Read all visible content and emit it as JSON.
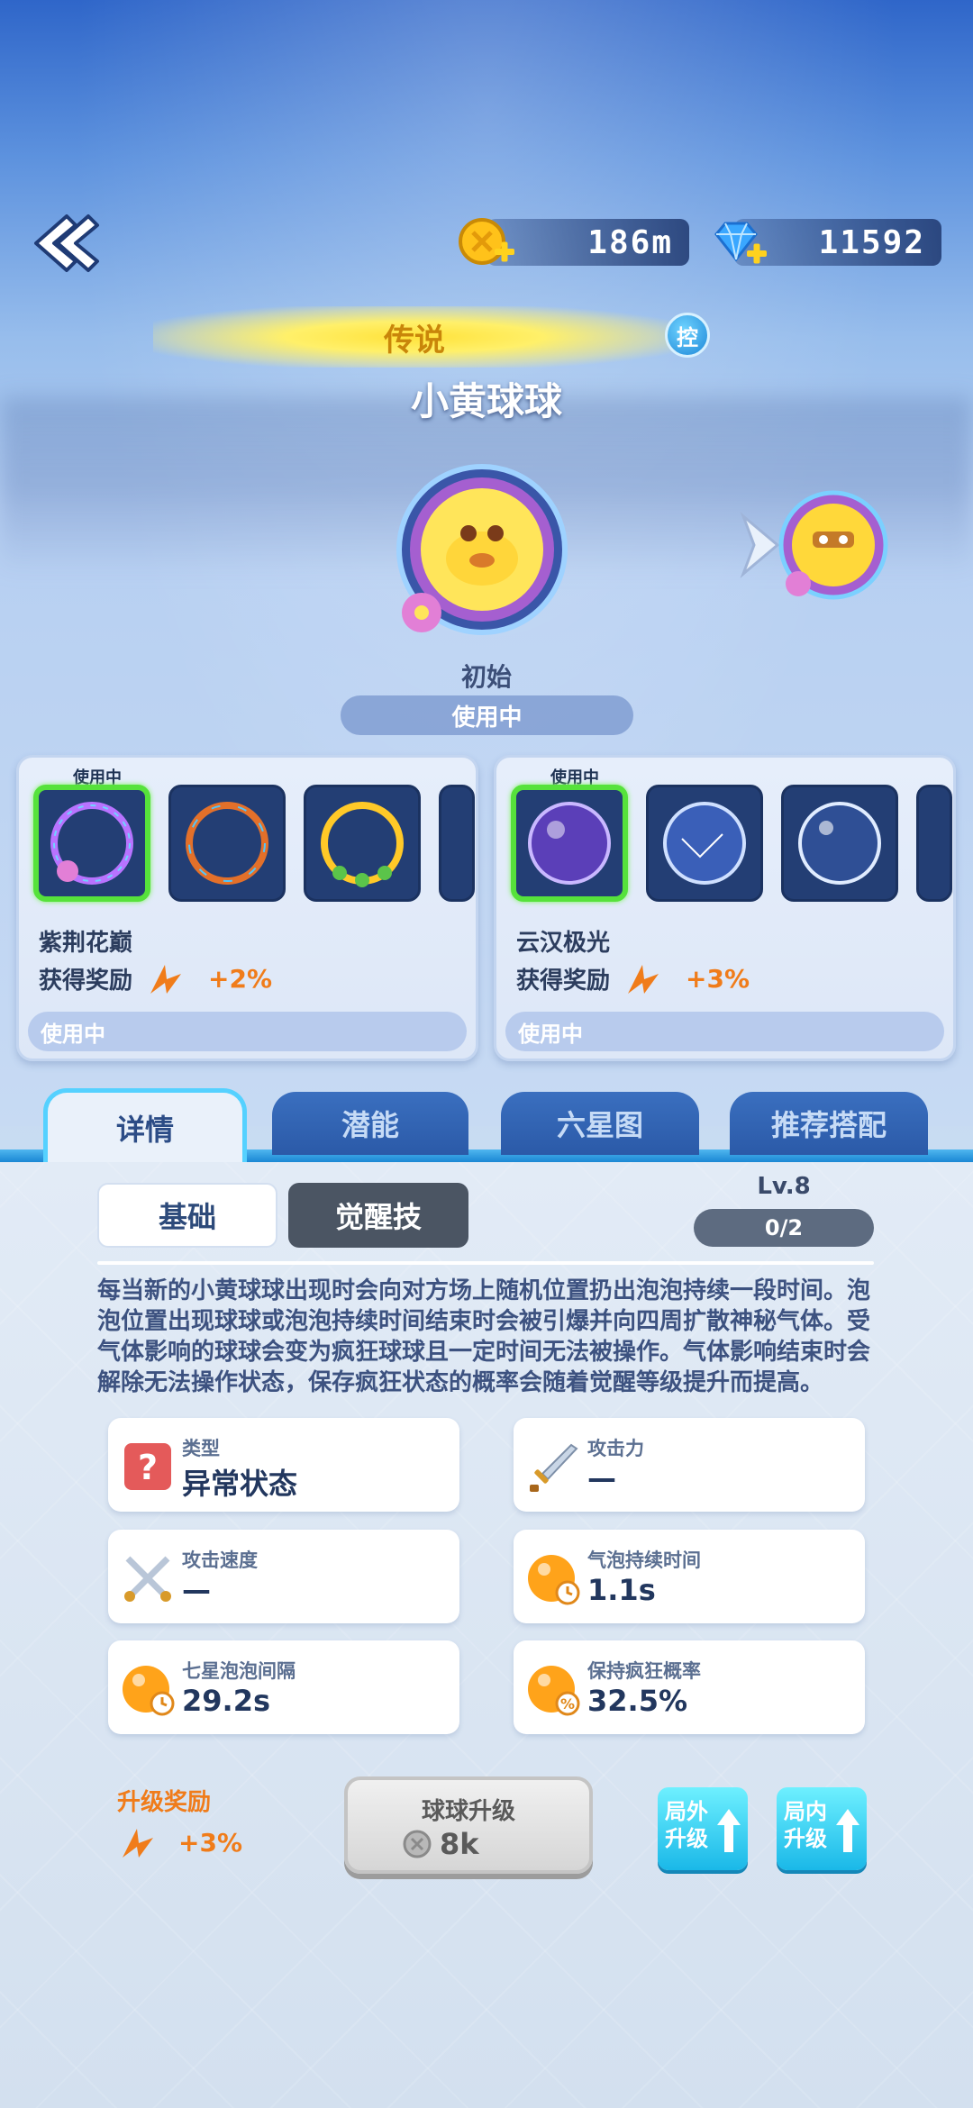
{
  "header": {
    "gold_value": "186m",
    "gem_value": "11592"
  },
  "hero": {
    "rarity": "传说",
    "control_badge": "控",
    "name": "小黄球球",
    "stage": "初始",
    "status": "使用中"
  },
  "skins": {
    "left": {
      "using_tag": "使用中",
      "name": "紫荆花巅",
      "reward_label": "获得奖励",
      "reward_value": "+2%",
      "status": "使用中"
    },
    "right": {
      "using_tag": "使用中",
      "name": "云汉极光",
      "reward_label": "获得奖励",
      "reward_value": "+3%",
      "status": "使用中"
    }
  },
  "tabs": [
    {
      "label": "详情"
    },
    {
      "label": "潜能"
    },
    {
      "label": "六星图"
    },
    {
      "label": "推荐搭配"
    }
  ],
  "detail": {
    "subtab_basic": "基础",
    "subtab_awaken": "觉醒技",
    "level": "Lv.8",
    "level_progress": "0/2",
    "description": "每当新的小黄球球出现时会向对方场上随机位置扔出泡泡持续一段时间。泡泡位置出现球球或泡泡持续时间结束时会被引爆并向四周扩散神秘气体。受气体影响的球球会变为疯狂球球且一定时间无法被操作。气体影响结束时会解除无法操作状态，保存疯狂状态的概率会随着觉醒等级提升而提高。"
  },
  "stats": [
    {
      "label": "类型",
      "value": "异常状态"
    },
    {
      "label": "攻击力",
      "value": "—"
    },
    {
      "label": "攻击速度",
      "value": "—"
    },
    {
      "label": "气泡持续时间",
      "value": "1.1s"
    },
    {
      "label": "七星泡泡间隔",
      "value": "29.2s"
    },
    {
      "label": "保持疯狂概率",
      "value": "32.5%"
    }
  ],
  "bottom": {
    "upgrade_reward_label": "升级奖励",
    "upgrade_reward_value": "+3%",
    "upgrade_button": "球球升级",
    "upgrade_cost": "8k",
    "outside_upgrade": [
      "局外",
      "升级"
    ],
    "inside_upgrade": [
      "局内",
      "升级"
    ]
  }
}
